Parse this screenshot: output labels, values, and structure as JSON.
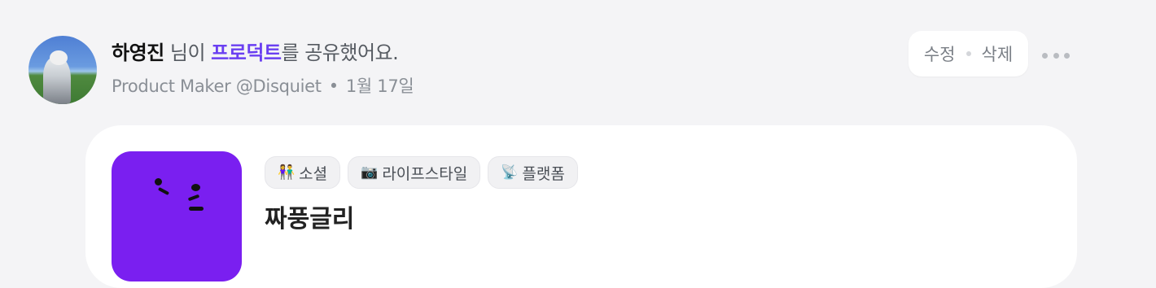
{
  "post": {
    "username": "하영진",
    "verb_pre": " 님이 ",
    "link_text": "프로덕트",
    "verb_post": "를 공유했어요.",
    "role": "Product Maker @Disquiet",
    "dot": "•",
    "date": "1월 17일"
  },
  "actions": {
    "edit_label": "수정",
    "delete_label": "삭제"
  },
  "product": {
    "tags": [
      {
        "icon": "👫",
        "label": "소셜"
      },
      {
        "icon": "📷",
        "label": "라이프스타일"
      },
      {
        "icon": "📡",
        "label": "플랫폼"
      }
    ],
    "title": "짜풍글리",
    "thumb_color": "#7a1ff0"
  },
  "colors": {
    "background": "#f4f4f6",
    "accent": "#6a3ff1"
  }
}
